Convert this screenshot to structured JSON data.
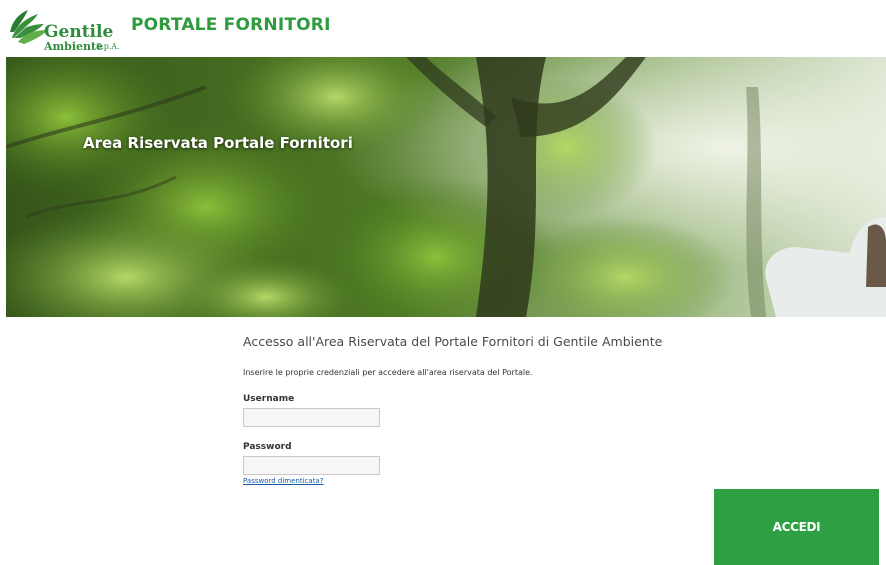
{
  "header": {
    "logo": {
      "word1": "Gentile",
      "word2": "Ambiente",
      "suffix": "S.p.A."
    },
    "title": "PORTALE FORNITORI"
  },
  "banner": {
    "title": "Area Riservata Portale Fornitori"
  },
  "login": {
    "heading": "Accesso all'Area Riservata del Portale Fornitori di Gentile Ambiente",
    "subtitle": "Inserire le proprie credenziali per accedere all'area riservata del Portale.",
    "username_label": "Username",
    "username_value": "",
    "password_label": "Password",
    "password_value": "",
    "forgot_link": "Password dimenticata?",
    "submit_label": "ACCEDI"
  },
  "colors": {
    "brand_green": "#2e9c3e",
    "button_green": "#2ea043",
    "link_blue": "#1a5aa0"
  },
  "icons": {
    "logo": "leaf-logo-icon"
  }
}
